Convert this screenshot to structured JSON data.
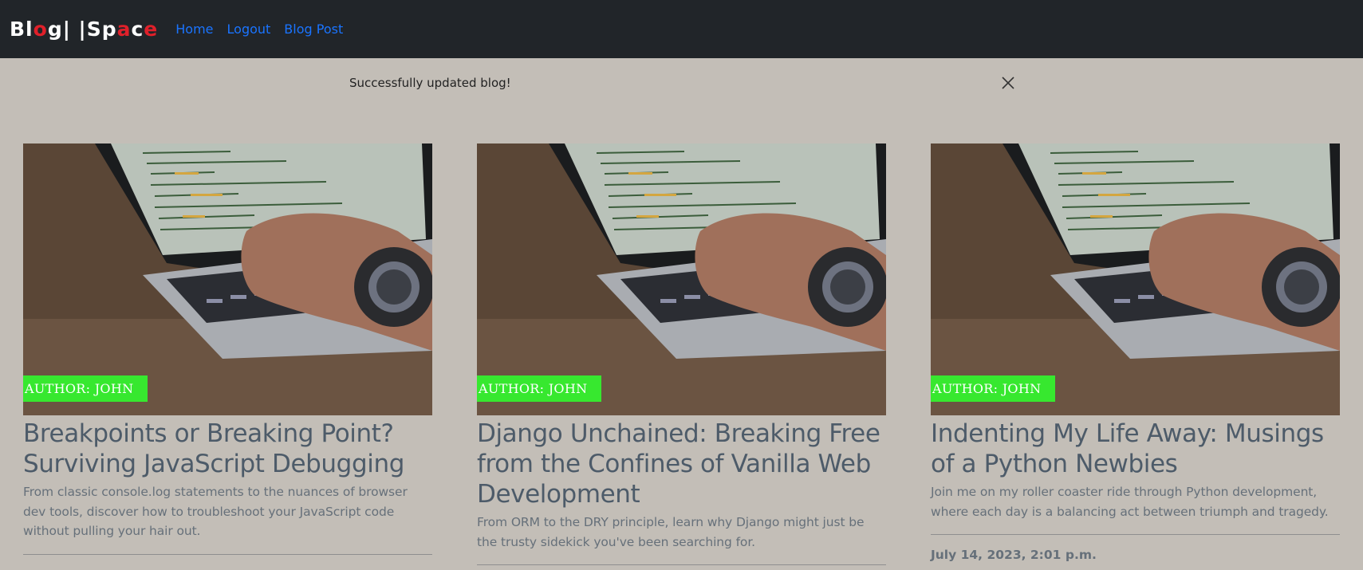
{
  "navbar": {
    "brand_parts": [
      "Bl",
      "o",
      "g",
      "| |",
      "Sp",
      "a",
      "c",
      "e"
    ],
    "links": [
      {
        "label": "Home"
      },
      {
        "label": "Logout"
      },
      {
        "label": "Blog Post"
      }
    ]
  },
  "alert": {
    "message": "Successfully updated blog!",
    "close_icon": "close-icon"
  },
  "colors": {
    "navbar_bg": "#212529",
    "page_bg": "#c3beb7",
    "link": "#1a74ff",
    "badge_bg": "#37e82f",
    "brand_accent": "#e0202a"
  },
  "cards": [
    {
      "author": "AUTHOR: JOHN",
      "title": "Breakpoints or Breaking Point? Surviving JavaScript Debugging",
      "description": "From classic console.log statements to the nuances of browser dev tools, discover how to troubleshoot your JavaScript code without pulling your hair out.",
      "date": ""
    },
    {
      "author": "AUTHOR: JOHN",
      "title": "Django Unchained: Breaking Free from the Confines of Vanilla Web Development",
      "description": "From ORM to the DRY principle, learn why Django might just be the trusty sidekick you've been searching for.",
      "date": ""
    },
    {
      "author": "AUTHOR: JOHN",
      "title": "Indenting My Life Away: Musings of a Python Newbies",
      "description": "Join me on my roller coaster ride through Python development, where each day is a balancing act between triumph and tragedy.",
      "date": "July 14, 2023, 2:01 p.m."
    }
  ]
}
